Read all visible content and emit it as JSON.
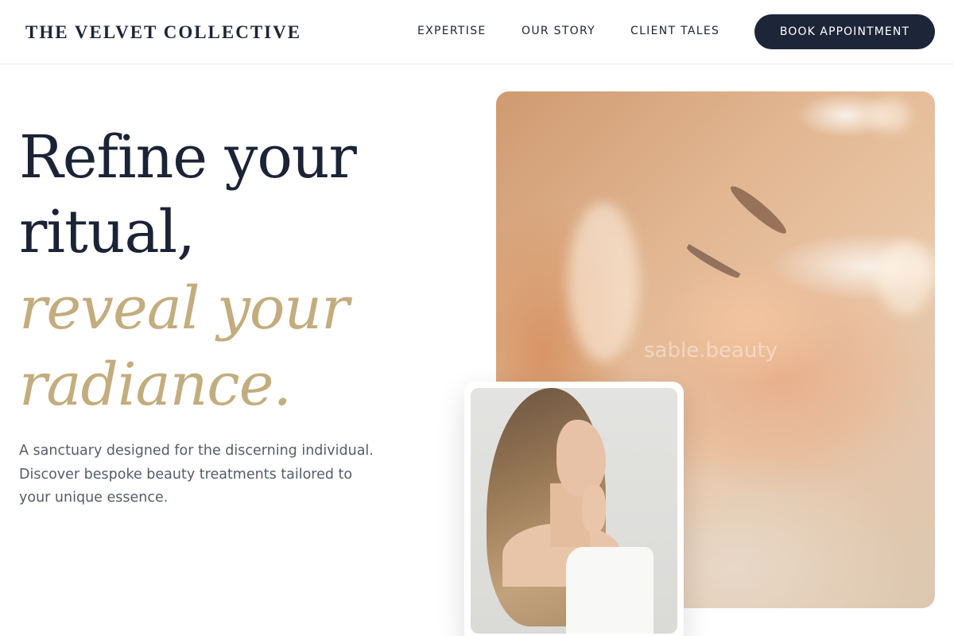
{
  "header": {
    "brand": "THE VELVET COLLECTIVE",
    "nav": [
      {
        "label": "EXPERTISE"
      },
      {
        "label": "OUR STORY"
      },
      {
        "label": "CLIENT TALES"
      }
    ],
    "cta_label": "BOOK APPOINTMENT"
  },
  "hero": {
    "headline": {
      "line1": "Refine your",
      "line2": "ritual,",
      "line3": "reveal your",
      "line4": "radiance."
    },
    "body": "A sanctuary designed for the discerning individual. Discover bespoke beauty treatments tailored to your unique essence.",
    "main_image": {
      "watermark": "sable.beauty"
    }
  },
  "colors": {
    "navy": "#1c2638",
    "gold": "#c3ad7e",
    "body_text": "#555c68",
    "background": "#ffffff"
  }
}
